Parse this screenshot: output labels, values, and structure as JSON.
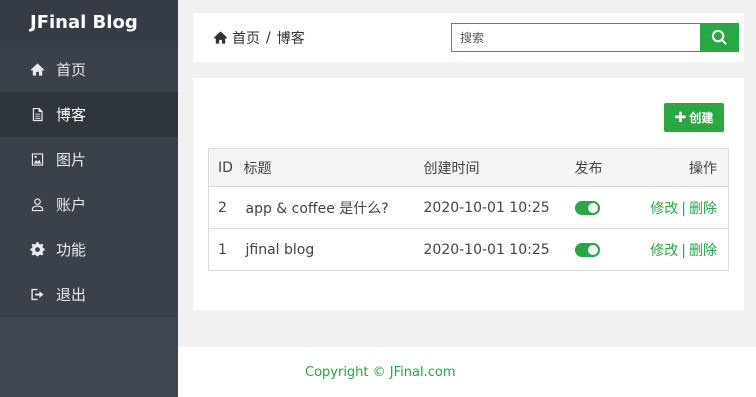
{
  "app": {
    "title": "JFinal Blog"
  },
  "sidebar": {
    "items": [
      {
        "label": "首页",
        "icon": "home-icon",
        "active": false
      },
      {
        "label": "博客",
        "icon": "document-icon",
        "active": true
      },
      {
        "label": "图片",
        "icon": "image-icon",
        "active": false
      },
      {
        "label": "账户",
        "icon": "user-icon",
        "active": false
      },
      {
        "label": "功能",
        "icon": "gear-icon",
        "active": false
      },
      {
        "label": "退出",
        "icon": "logout-icon",
        "active": false
      }
    ]
  },
  "header": {
    "breadcrumb": {
      "home": "首页",
      "separator": "/",
      "current": "博客"
    },
    "search": {
      "placeholder": "搜索",
      "value": ""
    }
  },
  "main": {
    "create_label": "创建",
    "table": {
      "columns": [
        "ID",
        "标题",
        "创建时间",
        "发布",
        "操作"
      ],
      "rows": [
        {
          "id": "2",
          "title": "app & coffee 是什么?",
          "created": "2020-10-01 10:25",
          "published": true,
          "edit": "修改",
          "sep": "|",
          "delete": "删除"
        },
        {
          "id": "1",
          "title": "jfinal blog",
          "created": "2020-10-01 10:25",
          "published": true,
          "edit": "修改",
          "sep": "|",
          "delete": "删除"
        }
      ]
    }
  },
  "footer": {
    "copyright": "Copyright © JFinal.com"
  },
  "colors": {
    "accent": "#28a745",
    "sidebar_bg": "#3e4650",
    "sidebar_active": "#2f353d"
  }
}
